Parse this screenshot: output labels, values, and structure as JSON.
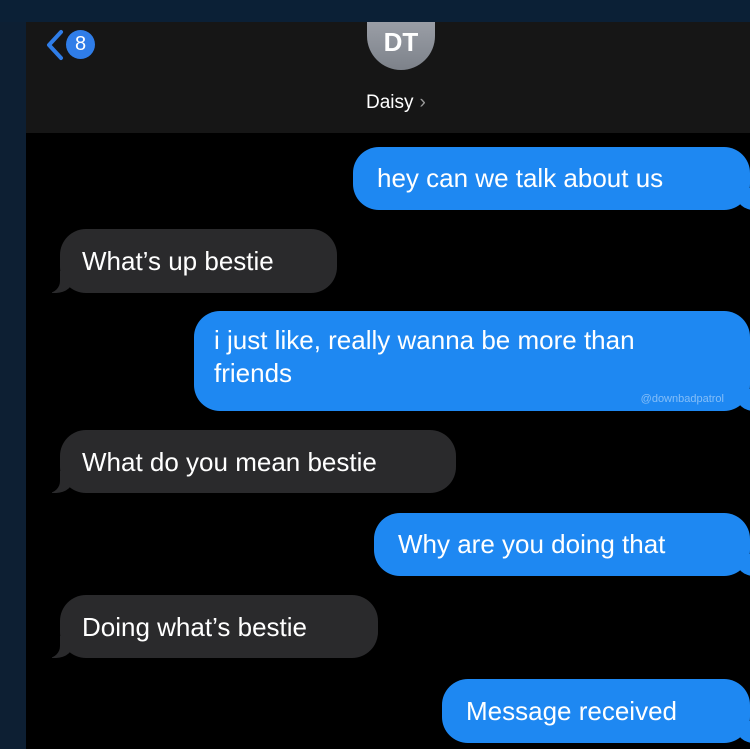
{
  "header": {
    "back_badge": "8",
    "avatar_initials": "DT",
    "contact_name": "Daisy",
    "contact_chevron": "›",
    "back_icon": "chevron-left-icon",
    "accent_color": "#2f7de8"
  },
  "colors": {
    "sent_bubble": "#1e88f2",
    "received_bubble": "#2a2a2c",
    "background": "#000000"
  },
  "messages": [
    {
      "direction": "sent",
      "text": "hey can we talk about us"
    },
    {
      "direction": "received",
      "text": "What’s up bestie"
    },
    {
      "direction": "sent",
      "line1": "i just like, really wanna be more than",
      "line2": "friends",
      "watermark": "@downbadpatrol"
    },
    {
      "direction": "received",
      "text": "What do you mean bestie"
    },
    {
      "direction": "sent",
      "text": "Why are you doing that"
    },
    {
      "direction": "received",
      "text": "Doing what’s bestie"
    },
    {
      "direction": "sent",
      "text": "Message received"
    }
  ]
}
